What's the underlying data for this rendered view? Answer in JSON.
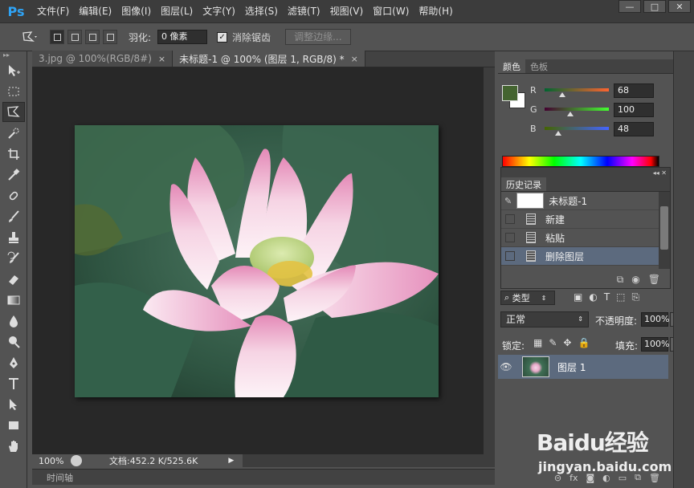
{
  "app": {
    "logo": "Ps"
  },
  "menu": [
    "文件(F)",
    "编辑(E)",
    "图像(I)",
    "图层(L)",
    "文字(Y)",
    "选择(S)",
    "滤镜(T)",
    "视图(V)",
    "窗口(W)",
    "帮助(H)"
  ],
  "window_controls": {
    "minimize": "—",
    "restore": "□",
    "close": "✕"
  },
  "options": {
    "feather_label": "羽化:",
    "feather_value": "0 像素",
    "antialias_label": "消除锯齿",
    "antialias_checked": true,
    "refine_edge_label": "调整边缘..."
  },
  "tabs": [
    {
      "label": "3.jpg @ 100%(RGB/8#)",
      "close": "×",
      "active": false
    },
    {
      "label": "未标题-1 @ 100% (图层 1, RGB/8) *",
      "close": "×",
      "active": true
    }
  ],
  "status": {
    "zoom": "100%",
    "doc_info": "文档:452.2 K/525.6K",
    "arrow": "▶"
  },
  "timeline_label": "时间轴",
  "color_panel": {
    "tabs": [
      "颜色",
      "色板"
    ],
    "foreground": "#446430",
    "background": "#ffffff",
    "channels": [
      {
        "name": "R",
        "value": "68",
        "fraction": 0.267
      },
      {
        "name": "G",
        "value": "100",
        "fraction": 0.392
      },
      {
        "name": "B",
        "value": "48",
        "fraction": 0.188
      }
    ]
  },
  "history_panel": {
    "tab": "历史记录",
    "snapshot": "未标题-1",
    "items": [
      {
        "label": "新建",
        "selected": false
      },
      {
        "label": "粘贴",
        "selected": false
      },
      {
        "label": "删除图层",
        "selected": true
      }
    ]
  },
  "layers_panel": {
    "filter_label": "类型",
    "blend_mode": "正常",
    "opacity_label": "不透明度:",
    "opacity_value": "100%",
    "lock_label": "锁定:",
    "fill_label": "填充:",
    "fill_value": "100%",
    "layers": [
      {
        "name": "图层 1",
        "visible": true,
        "selected": true
      }
    ]
  },
  "watermark": {
    "main": "Baidu经验",
    "sub": "jingyan.baidu.com"
  },
  "colors": {
    "accent_selected": "#5c6a7e",
    "ps_logo": "#2fa3f5"
  }
}
